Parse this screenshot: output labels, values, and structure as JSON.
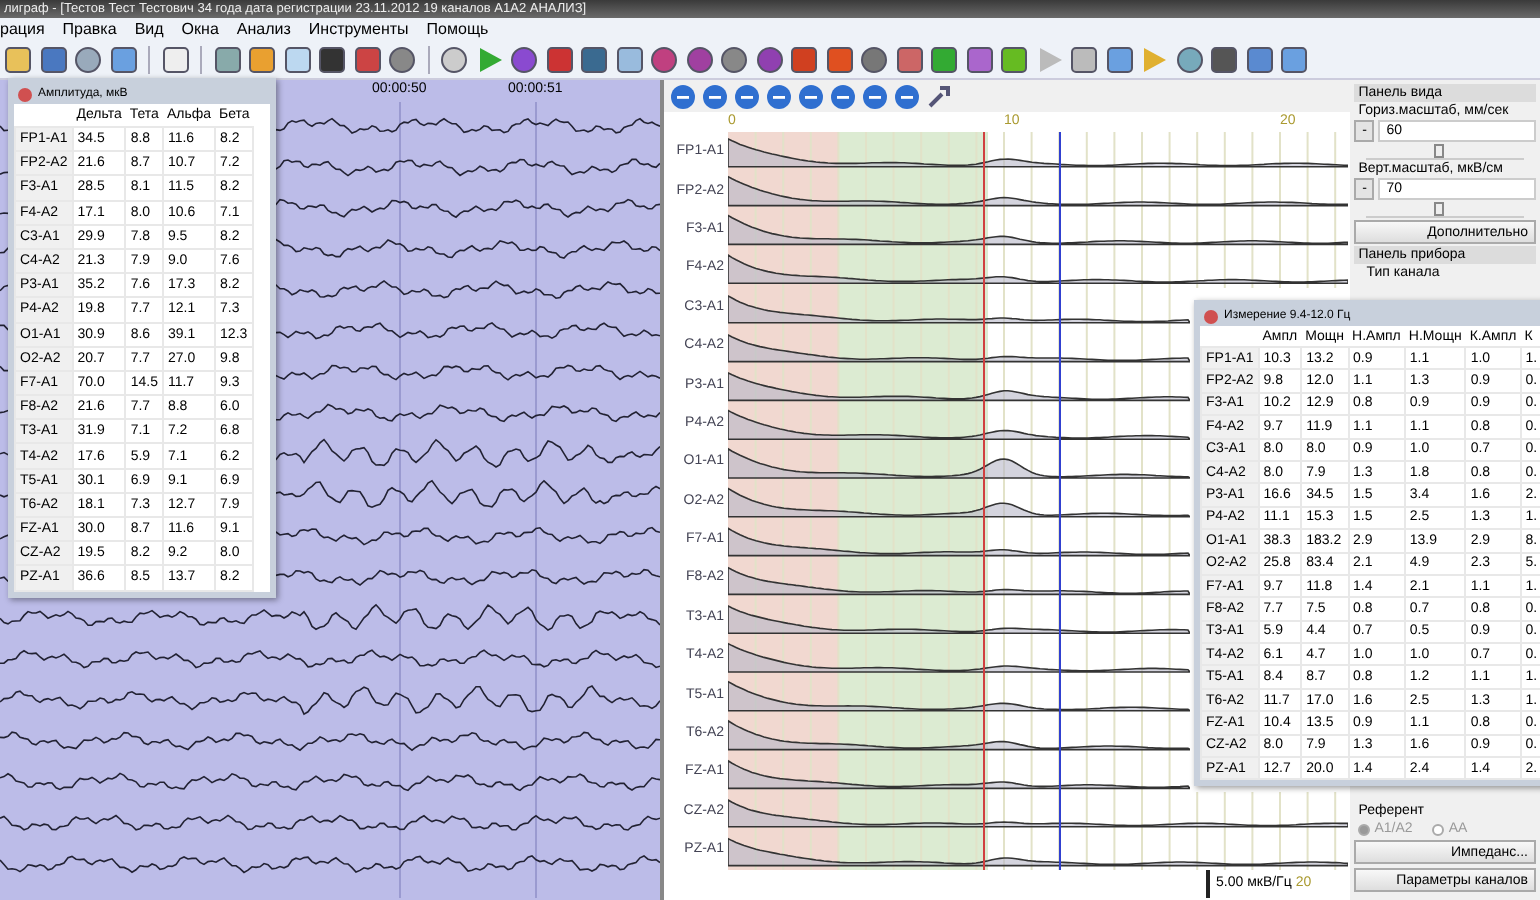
{
  "window": {
    "title": "лиграф - [Тестов Тест Тестович 34 года дата регистрации 23.11.2012 19 каналов A1A2 АНАЛИЗ]"
  },
  "menu": [
    "рация",
    "Правка",
    "Вид",
    "Окна",
    "Анализ",
    "Инструменты",
    "Помощь"
  ],
  "eeg": {
    "time_labels": [
      "00:00:50",
      "00:00:51"
    ]
  },
  "amplitude_window": {
    "title": "Амплитуда, мкВ",
    "columns": [
      "Дельта",
      "Тета",
      "Альфа",
      "Бета"
    ],
    "rows": [
      {
        "channel": "FP1-A1",
        "values": [
          "34.5",
          "8.8",
          "11.6",
          "8.2"
        ]
      },
      {
        "channel": "FP2-A2",
        "values": [
          "21.6",
          "8.7",
          "10.7",
          "7.2"
        ]
      },
      {
        "channel": "F3-A1",
        "values": [
          "28.5",
          "8.1",
          "11.5",
          "8.2"
        ]
      },
      {
        "channel": "F4-A2",
        "values": [
          "17.1",
          "8.0",
          "10.6",
          "7.1"
        ]
      },
      {
        "channel": "C3-A1",
        "values": [
          "29.9",
          "7.8",
          "9.5",
          "8.2"
        ]
      },
      {
        "channel": "C4-A2",
        "values": [
          "21.3",
          "7.9",
          "9.0",
          "7.6"
        ]
      },
      {
        "channel": "P3-A1",
        "values": [
          "35.2",
          "7.6",
          "17.3",
          "8.2"
        ]
      },
      {
        "channel": "P4-A2",
        "values": [
          "19.8",
          "7.7",
          "12.1",
          "7.3"
        ]
      },
      {
        "channel": "O1-A1",
        "values": [
          "30.9",
          "8.6",
          "39.1",
          "12.3"
        ]
      },
      {
        "channel": "O2-A2",
        "values": [
          "20.7",
          "7.7",
          "27.0",
          "9.8"
        ]
      },
      {
        "channel": "F7-A1",
        "values": [
          "70.0",
          "14.5",
          "11.7",
          "9.3"
        ]
      },
      {
        "channel": "F8-A2",
        "values": [
          "21.6",
          "7.7",
          "8.8",
          "6.0"
        ]
      },
      {
        "channel": "T3-A1",
        "values": [
          "31.9",
          "7.1",
          "7.2",
          "6.8"
        ]
      },
      {
        "channel": "T4-A2",
        "values": [
          "17.6",
          "5.9",
          "7.1",
          "6.2"
        ]
      },
      {
        "channel": "T5-A1",
        "values": [
          "30.1",
          "6.9",
          "9.1",
          "6.9"
        ]
      },
      {
        "channel": "T6-A2",
        "values": [
          "18.1",
          "7.3",
          "12.7",
          "7.9"
        ]
      },
      {
        "channel": "FZ-A1",
        "values": [
          "30.0",
          "8.7",
          "11.6",
          "9.1"
        ]
      },
      {
        "channel": "CZ-A2",
        "values": [
          "19.5",
          "8.2",
          "9.2",
          "8.0"
        ]
      },
      {
        "channel": "PZ-A1",
        "values": [
          "36.6",
          "8.5",
          "13.7",
          "8.2"
        ]
      }
    ]
  },
  "spectrum": {
    "axis_labels": [
      "0",
      "10",
      "20"
    ],
    "channels": [
      "FP1-A1",
      "FP2-A2",
      "F3-A1",
      "F4-A2",
      "C3-A1",
      "C4-A2",
      "P3-A1",
      "P4-A2",
      "O1-A1",
      "O2-A2",
      "F7-A1",
      "F8-A2",
      "T3-A1",
      "T4-A2",
      "T5-A1",
      "T6-A2",
      "FZ-A1",
      "CZ-A2",
      "PZ-A1"
    ],
    "scale_label": "5.00 мкВ/Гц",
    "scale_tick": "20"
  },
  "measure_window": {
    "title": "Измерение 9.4-12.0 Гц",
    "columns": [
      "Ампл",
      "Мощн",
      "Н.Ампл",
      "Н.Мощн",
      "К.Ампл",
      "К"
    ],
    "rows": [
      {
        "channel": "FP1-A1",
        "values": [
          "10.3",
          "13.2",
          "0.9",
          "1.1",
          "1.0",
          "1."
        ]
      },
      {
        "channel": "FP2-A2",
        "values": [
          "9.8",
          "12.0",
          "1.1",
          "1.3",
          "0.9",
          "0."
        ]
      },
      {
        "channel": "F3-A1",
        "values": [
          "10.2",
          "12.9",
          "0.8",
          "0.9",
          "0.9",
          "0."
        ]
      },
      {
        "channel": "F4-A2",
        "values": [
          "9.7",
          "11.9",
          "1.1",
          "1.1",
          "0.8",
          "0."
        ]
      },
      {
        "channel": "C3-A1",
        "values": [
          "8.0",
          "8.0",
          "0.9",
          "1.0",
          "0.7",
          "0."
        ]
      },
      {
        "channel": "C4-A2",
        "values": [
          "8.0",
          "7.9",
          "1.3",
          "1.8",
          "0.8",
          "0."
        ]
      },
      {
        "channel": "P3-A1",
        "values": [
          "16.6",
          "34.5",
          "1.5",
          "3.4",
          "1.6",
          "2."
        ]
      },
      {
        "channel": "P4-A2",
        "values": [
          "11.1",
          "15.3",
          "1.5",
          "2.5",
          "1.3",
          "1."
        ]
      },
      {
        "channel": "O1-A1",
        "values": [
          "38.3",
          "183.2",
          "2.9",
          "13.9",
          "2.9",
          "8."
        ]
      },
      {
        "channel": "O2-A2",
        "values": [
          "25.8",
          "83.4",
          "2.1",
          "4.9",
          "2.3",
          "5."
        ]
      },
      {
        "channel": "F7-A1",
        "values": [
          "9.7",
          "11.8",
          "1.4",
          "2.1",
          "1.1",
          "1."
        ]
      },
      {
        "channel": "F8-A2",
        "values": [
          "7.7",
          "7.5",
          "0.8",
          "0.7",
          "0.8",
          "0."
        ]
      },
      {
        "channel": "T3-A1",
        "values": [
          "5.9",
          "4.4",
          "0.7",
          "0.5",
          "0.9",
          "0."
        ]
      },
      {
        "channel": "T4-A2",
        "values": [
          "6.1",
          "4.7",
          "1.0",
          "1.0",
          "0.7",
          "0."
        ]
      },
      {
        "channel": "T5-A1",
        "values": [
          "8.4",
          "8.7",
          "0.8",
          "1.2",
          "1.1",
          "1."
        ]
      },
      {
        "channel": "T6-A2",
        "values": [
          "11.7",
          "17.0",
          "1.6",
          "2.5",
          "1.3",
          "1."
        ]
      },
      {
        "channel": "FZ-A1",
        "values": [
          "10.4",
          "13.5",
          "0.9",
          "1.1",
          "0.8",
          "0."
        ]
      },
      {
        "channel": "CZ-A2",
        "values": [
          "8.0",
          "7.9",
          "1.3",
          "1.6",
          "0.9",
          "0."
        ]
      },
      {
        "channel": "PZ-A1",
        "values": [
          "12.7",
          "20.0",
          "1.4",
          "2.4",
          "1.4",
          "2."
        ]
      }
    ]
  },
  "side_panel": {
    "view_header": "Панель вида",
    "horiz_label": "Гориз.масштаб, мм/сек",
    "horiz_minus": "-",
    "horiz_value": "60",
    "horiz_slider": {
      "level": 0.43
    },
    "vert_label": "Верт.масштаб, мкВ/см",
    "vert_minus": "-",
    "vert_value": "70",
    "vert_slider": {
      "level": 0.43
    },
    "more_button": "Дополнительно",
    "device_header": "Панель прибора",
    "channel_type": "Тип канала",
    "reference_label": "Референт",
    "reference_options": [
      {
        "label": "A1/A2",
        "selected": true
      },
      {
        "label": "AA",
        "selected": false
      }
    ],
    "impedance_button": "Импеданс...",
    "channels_button": "Параметры каналов"
  }
}
